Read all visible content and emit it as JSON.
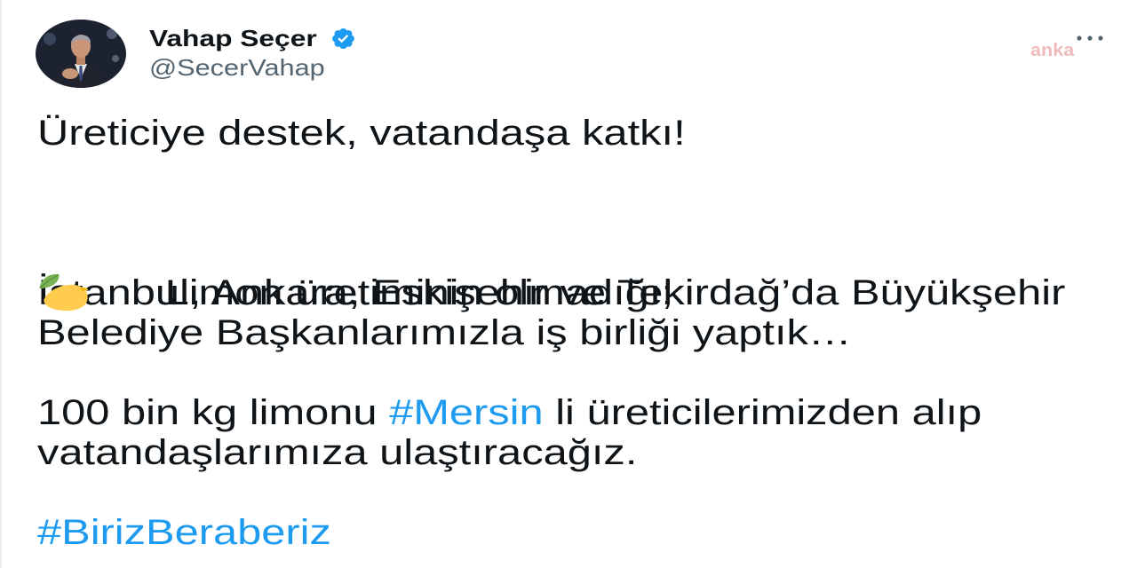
{
  "tweet": {
    "author": {
      "name": "Vahap Seçer",
      "handle": "@SecerVahap",
      "avatar_icon": "avatar",
      "verified_icon": "verified-badge-icon"
    },
    "more_icon": "more-icon",
    "watermark": "anka",
    "text": {
      "intro": "Üreticiye destek, vatandaşa katkı!",
      "lemon_icon": "lemon-emoji-icon",
      "lemon_line": "Limon üretiminin olmadığı;",
      "cities_line_1": "İstanbul, Ankara, Eskişehir ve Tekirdağ’da Büyükşehir",
      "cities_line_2": "Belediye Başkanlarımızla iş birliği yaptık…",
      "purchase_line_1_before": "100 bin kg limonu ",
      "purchase_hashtag": "#Mersin",
      "purchase_line_1_after": " li üreticilerimizden alıp",
      "purchase_line_2": "vatandaşlarımıza ulaştıracağız.",
      "closing_hashtag": "#BirizBeraberiz"
    }
  },
  "colors": {
    "text": "#0f1419",
    "secondary": "#536471",
    "accent": "#1d9bf0",
    "watermark": "#d23c3c"
  }
}
